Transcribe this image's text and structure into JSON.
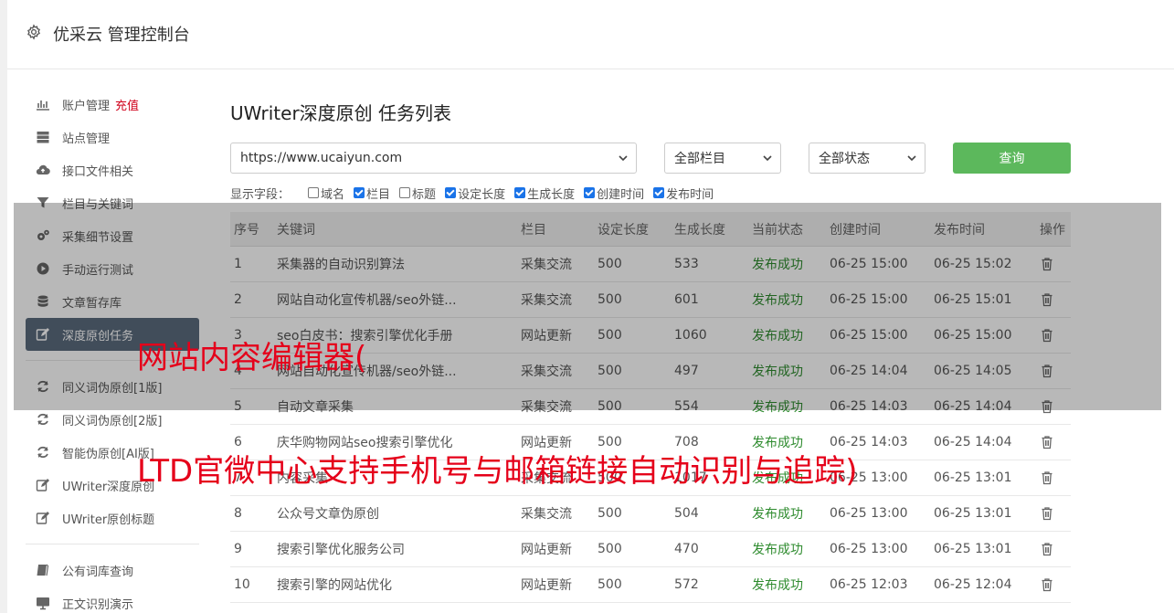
{
  "app": {
    "title": "优采云 管理控制台"
  },
  "sidebar": {
    "items": [
      {
        "label": "账户管理",
        "icon": "bar-chart-icon",
        "extra": "充值"
      },
      {
        "label": "站点管理",
        "icon": "server-icon"
      },
      {
        "label": "接口文件相关",
        "icon": "cloud-upload-icon"
      },
      {
        "label": "栏目与关键词",
        "icon": "filter-icon"
      },
      {
        "label": "采集细节设置",
        "icon": "gears-icon"
      },
      {
        "label": "手动运行测试",
        "icon": "play-circle-icon"
      },
      {
        "label": "文章暂存库",
        "icon": "database-icon"
      },
      {
        "label": "深度原创任务",
        "icon": "edit-icon",
        "active": true
      },
      {
        "label": "同义词伪原创[1版]",
        "icon": "refresh-icon"
      },
      {
        "label": "同义词伪原创[2版]",
        "icon": "refresh-icon"
      },
      {
        "label": "智能伪原创[AI版]",
        "icon": "refresh-icon"
      },
      {
        "label": "UWriter深度原创",
        "icon": "edit-icon"
      },
      {
        "label": "UWriter原创标题",
        "icon": "edit-icon"
      },
      {
        "label": "公有词库查询",
        "icon": "book-icon"
      },
      {
        "label": "正文识别演示",
        "icon": "monitor-icon"
      }
    ]
  },
  "main": {
    "title": "UWriter深度原创 任务列表",
    "site_select": "https://www.ucaiyun.com",
    "column_select": "全部栏目",
    "status_select": "全部状态",
    "query_label": "查询",
    "fields_label": "显示字段：",
    "fields": [
      {
        "label": "域名",
        "checked": false
      },
      {
        "label": "栏目",
        "checked": true
      },
      {
        "label": "标题",
        "checked": false
      },
      {
        "label": "设定长度",
        "checked": true
      },
      {
        "label": "生成长度",
        "checked": true
      },
      {
        "label": "创建时间",
        "checked": true
      },
      {
        "label": "发布时间",
        "checked": true
      }
    ]
  },
  "table": {
    "headers": [
      "序号",
      "关键词",
      "栏目",
      "设定长度",
      "生成长度",
      "当前状态",
      "创建时间",
      "发布时间",
      "操作"
    ],
    "rows": [
      [
        "1",
        "采集器的自动识别算法",
        "采集交流",
        "500",
        "533",
        "发布成功",
        "06-25 15:00",
        "06-25 15:02"
      ],
      [
        "2",
        "网站自动化宣传机器/seo外链...",
        "采集交流",
        "500",
        "601",
        "发布成功",
        "06-25 15:00",
        "06-25 15:01"
      ],
      [
        "3",
        "seo白皮书：搜索引擎优化手册",
        "网站更新",
        "500",
        "1060",
        "发布成功",
        "06-25 15:00",
        "06-25 15:00"
      ],
      [
        "4",
        "网站自动化宣传机器/seo外链...",
        "采集交流",
        "500",
        "497",
        "发布成功",
        "06-25 14:04",
        "06-25 14:05"
      ],
      [
        "5",
        "自动文章采集",
        "采集交流",
        "500",
        "554",
        "发布成功",
        "06-25 14:03",
        "06-25 14:04"
      ],
      [
        "6",
        "庆华购物网站seo搜索引擎优化",
        "网站更新",
        "500",
        "708",
        "发布成功",
        "06-25 14:03",
        "06-25 14:04"
      ],
      [
        "7",
        "内容采集",
        "采集交流",
        "500",
        "1017",
        "发布成功",
        "06-25 13:00",
        "06-25 13:01"
      ],
      [
        "8",
        "公众号文章伪原创",
        "采集交流",
        "500",
        "504",
        "发布成功",
        "06-25 13:00",
        "06-25 13:01"
      ],
      [
        "9",
        "搜索引擎优化服务公司",
        "网站更新",
        "500",
        "470",
        "发布成功",
        "06-25 13:00",
        "06-25 13:01"
      ],
      [
        "10",
        "搜索引擎的网站优化",
        "网站更新",
        "500",
        "572",
        "发布成功",
        "06-25 12:03",
        "06-25 12:04"
      ]
    ]
  },
  "overlay": {
    "line1": "网站内容编辑器(",
    "line2": "LTD官微中心支持手机号与邮箱链接自动识别与追踪)",
    "color": "#e5001a"
  }
}
